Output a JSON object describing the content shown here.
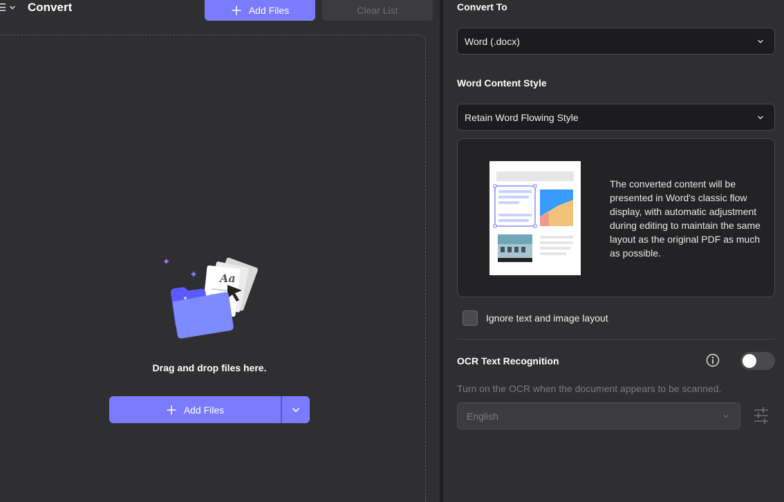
{
  "header": {
    "title": "Convert",
    "add_files_label": "Add Files",
    "clear_list_label": "Clear List"
  },
  "dropzone": {
    "message": "Drag and drop files here.",
    "add_files_label": "Add Files",
    "illustration_text": "Aa"
  },
  "settings": {
    "convert_to_label": "Convert To",
    "convert_to_value": "Word (.docx)",
    "content_style_label": "Word Content Style",
    "content_style_value": "Retain Word Flowing Style",
    "preview_description": "The converted content will be presented in Word's classic flow display, with automatic adjustment during editing to maintain the same layout as the original PDF as much as possible.",
    "ignore_layout_label": "Ignore text and image layout",
    "ignore_layout_checked": false,
    "ocr_label": "OCR Text Recognition",
    "ocr_enabled": false,
    "ocr_hint": "Turn on the OCR when the document appears to be scanned.",
    "ocr_language": "English"
  },
  "colors": {
    "accent": "#7b7bff",
    "background": "#2f2f31",
    "panel": "#1c1c1e"
  },
  "icons": [
    "menu-icon",
    "chevron-down-icon",
    "plus-icon",
    "folder-files-icon",
    "info-icon",
    "sliders-icon"
  ]
}
